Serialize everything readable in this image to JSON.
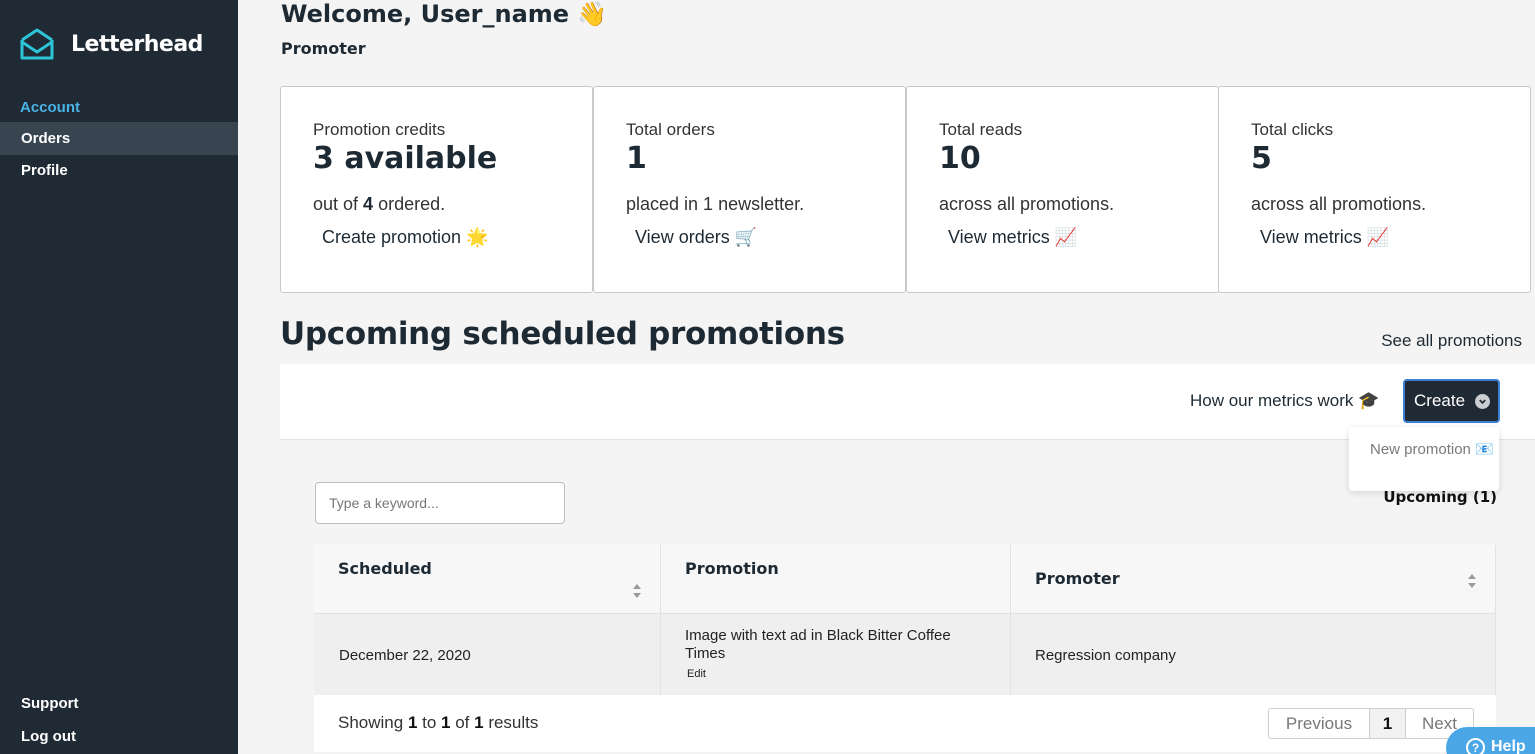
{
  "sidebar": {
    "brand": "Letterhead",
    "section_label": "Account",
    "items": [
      {
        "label": "Orders"
      },
      {
        "label": "Profile"
      }
    ],
    "bottom_items": [
      {
        "label": "Support"
      },
      {
        "label": "Log out"
      }
    ]
  },
  "header": {
    "welcome": "Welcome, User_name 👋",
    "role": "Promoter"
  },
  "cards": [
    {
      "label": "Promotion credits",
      "value": "3 available",
      "desc_pre": "out of ",
      "desc_bold": "4",
      "desc_post": " ordered.",
      "link": "Create promotion 🌟"
    },
    {
      "label": "Total orders",
      "value": "1",
      "desc": "placed in 1 newsletter.",
      "link": "View orders 🛒"
    },
    {
      "label": "Total reads",
      "value": "10",
      "desc": "across all promotions.",
      "link": "View metrics 📈"
    },
    {
      "label": "Total clicks",
      "value": "5",
      "desc": "across all promotions.",
      "link": "View metrics 📈"
    }
  ],
  "section": {
    "title": "Upcoming scheduled promotions",
    "see_all": "See all promotions"
  },
  "toolbar": {
    "metrics_link": "How our metrics work 🎓",
    "create_label": "Create",
    "dropdown_item": "New promotion 📧"
  },
  "search": {
    "placeholder": "Type a keyword..."
  },
  "upcoming_label": "Upcoming (1)",
  "table": {
    "columns": [
      "Scheduled",
      "Promotion",
      "Promoter"
    ],
    "rows": [
      {
        "scheduled": "December 22, 2020",
        "promotion": "Image with text ad in Black Bitter Coffee Times",
        "edit": "Edit",
        "promoter": "Regression company"
      }
    ]
  },
  "footer": {
    "showing_pre": "Showing ",
    "from": "1",
    "to_word": " to ",
    "to": "1",
    "of_word": " of ",
    "total": "1",
    "results_word": " results",
    "prev": "Previous",
    "current": "1",
    "next": "Next"
  },
  "help": {
    "icon": "?",
    "label": "Help"
  },
  "colors": {
    "sidebar_bg": "#1f2a34",
    "accent": "#4ab3e6",
    "logo_teal": "#2ec4d8",
    "create_border": "#3a7fd6"
  }
}
